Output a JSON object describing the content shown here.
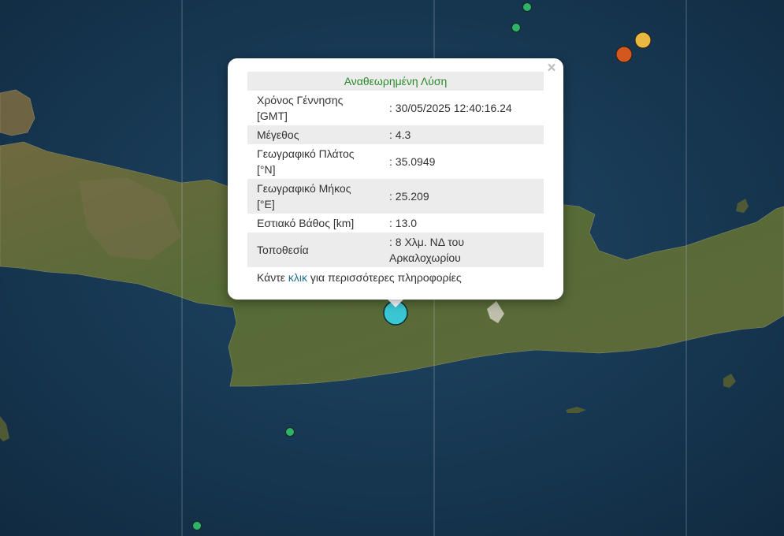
{
  "popup": {
    "header": "Αναθεωρημένη Λύση",
    "close_glyph": "×",
    "rows": [
      {
        "label": "Χρόνος Γέννησης [GMT]",
        "value": ": 30/05/2025 12:40:16.24"
      },
      {
        "label": "Μέγεθος",
        "value": ": 4.3"
      },
      {
        "label": "Γεωγραφικό Πλάτος [°N]",
        "value": ": 35.0949"
      },
      {
        "label": "Γεωγραφικό Μήκος [°E]",
        "value": ": 25.209"
      },
      {
        "label": "Εστιακό Βάθος [km]",
        "value": ": 13.0"
      },
      {
        "label": "Τοποθεσία",
        "value": ": 8 Χλμ. ΝΔ του Αρκαλοχωρίου"
      }
    ],
    "footer": {
      "prefix": "Κάντε ",
      "link": "κλικ",
      "suffix": " για περισσότερες πληροφορίες"
    }
  },
  "colors": {
    "sea": "#16344d",
    "land": "#5f6b3c",
    "selected_marker": "#3bc6d3",
    "marker_green": "#2db36a",
    "marker_orange": "#d2581e",
    "marker_yellow": "#e8b840",
    "header_green": "#2a8a2a",
    "link": "#1f6f8b"
  },
  "markers": [
    {
      "name": "selected-earthquake-marker",
      "color": "#3bc6d3"
    },
    {
      "name": "earthquake-marker-green",
      "color": "#2db36a"
    },
    {
      "name": "earthquake-marker-green",
      "color": "#2db36a"
    },
    {
      "name": "earthquake-marker-green",
      "color": "#2db36a"
    },
    {
      "name": "earthquake-marker-green",
      "color": "#2db36a"
    },
    {
      "name": "earthquake-marker-orange",
      "color": "#d2581e"
    },
    {
      "name": "earthquake-marker-yellow",
      "color": "#e8b840"
    }
  ]
}
